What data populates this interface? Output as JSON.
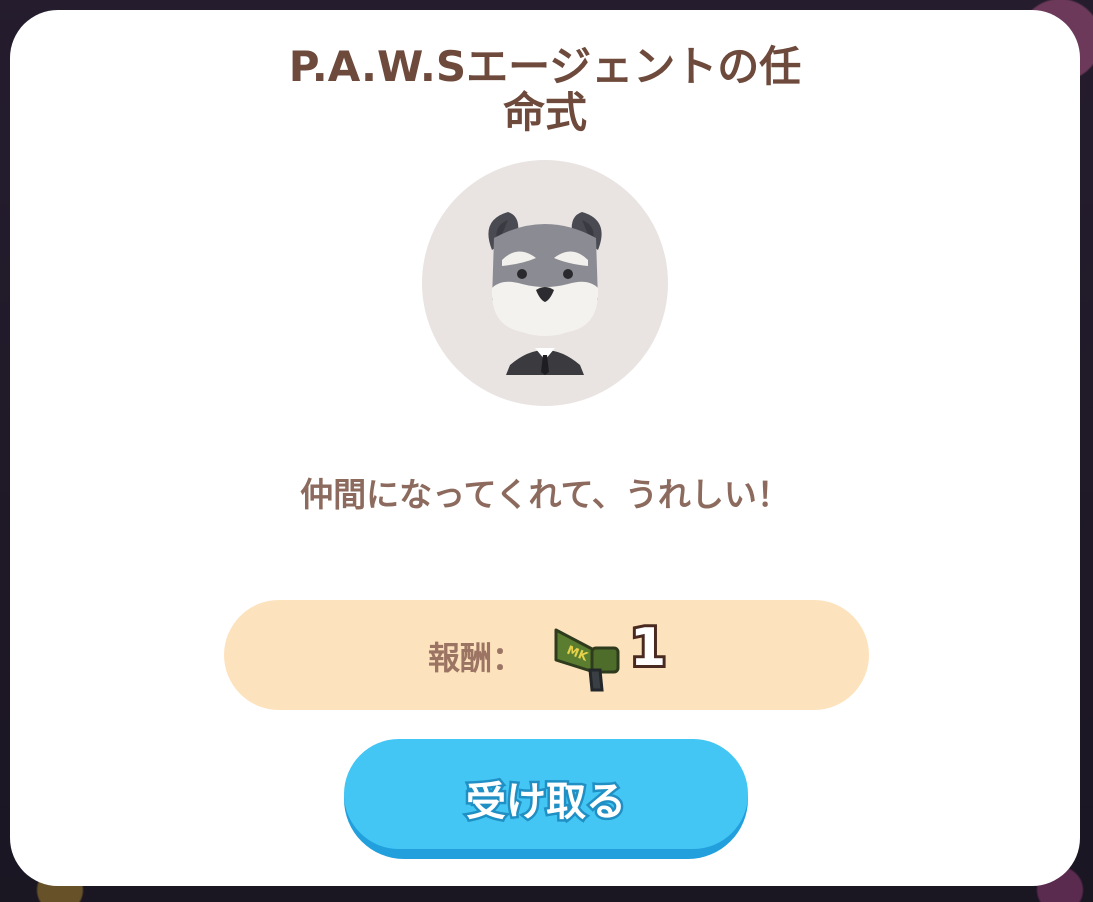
{
  "dialog": {
    "title_line1": "P.A.W.Sエージェントの任",
    "title_line2": "命式",
    "portrait_icon": "schnauzer-agent-avatar",
    "message": "仲間になってくれて、うれしい！",
    "reward": {
      "label": "報酬：",
      "item_icon": "megaphone-icon",
      "item_text": "MK",
      "count": "1"
    },
    "receive_button_label": "受け取る"
  },
  "colors": {
    "title": "#6e4a3c",
    "message": "#8c6b5e",
    "reward_pill": "#fde3bd",
    "button": "#44c6f4",
    "button_shadow": "#22a0dd"
  }
}
